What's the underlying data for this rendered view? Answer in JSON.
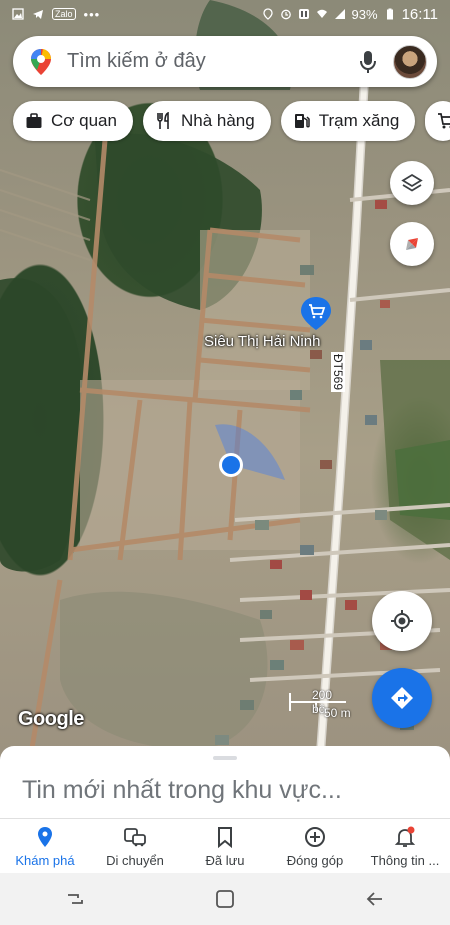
{
  "status_bar": {
    "battery": "93%",
    "time": "16:11"
  },
  "search": {
    "placeholder": "Tìm kiếm ở đây"
  },
  "chips": [
    {
      "label": "Cơ quan",
      "icon": "briefcase-icon"
    },
    {
      "label": "Nhà hàng",
      "icon": "restaurant-icon"
    },
    {
      "label": "Trạm xăng",
      "icon": "gas-station-icon"
    }
  ],
  "map": {
    "place_label": "Siêu Thị Hải Ninh",
    "road_label": "ĐT569",
    "attribution": "Google",
    "scale_imperial": "200 bộ",
    "scale_metric": "50 m"
  },
  "sheet": {
    "title": "Tin mới nhất trong khu vực..."
  },
  "bottom_nav": [
    {
      "label": "Khám phá",
      "icon": "explore-pin-icon",
      "active": true
    },
    {
      "label": "Di chuyển",
      "icon": "commute-icon",
      "active": false
    },
    {
      "label": "Đã lưu",
      "icon": "bookmark-icon",
      "active": false
    },
    {
      "label": "Đóng góp",
      "icon": "add-circle-icon",
      "active": false
    },
    {
      "label": "Thông tin ...",
      "icon": "notification-bell-icon",
      "active": false
    }
  ],
  "colors": {
    "accent": "#1a73e8",
    "notification_dot": "#ea4335"
  }
}
